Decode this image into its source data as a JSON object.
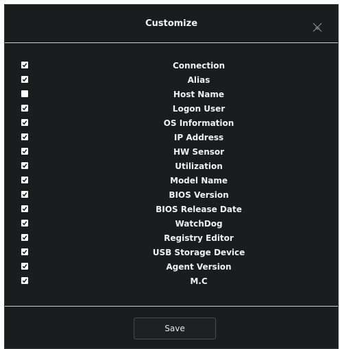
{
  "dialog": {
    "title": "Customize",
    "close_icon": "close-icon",
    "save_label": "Save"
  },
  "columns": [
    {
      "label": "Connection",
      "checked": true
    },
    {
      "label": "Alias",
      "checked": true
    },
    {
      "label": "Host Name",
      "checked": false
    },
    {
      "label": "Logon User",
      "checked": true
    },
    {
      "label": "OS Information",
      "checked": true
    },
    {
      "label": "IP Address",
      "checked": true
    },
    {
      "label": "HW Sensor",
      "checked": true
    },
    {
      "label": "Utilization",
      "checked": true
    },
    {
      "label": "Model Name",
      "checked": true
    },
    {
      "label": "BIOS Version",
      "checked": true
    },
    {
      "label": "BIOS Release Date",
      "checked": true
    },
    {
      "label": "WatchDog",
      "checked": true
    },
    {
      "label": "Registry Editor",
      "checked": true
    },
    {
      "label": "USB Storage Device",
      "checked": true
    },
    {
      "label": "Agent Version",
      "checked": true
    },
    {
      "label": "M.C",
      "checked": true
    }
  ],
  "colors": {
    "background": "#1b1c1e",
    "text": "#f0f0f0",
    "divider": "#cfcfcf",
    "checkbox": "#ffffff",
    "checkmark": "#1b1c1e"
  }
}
